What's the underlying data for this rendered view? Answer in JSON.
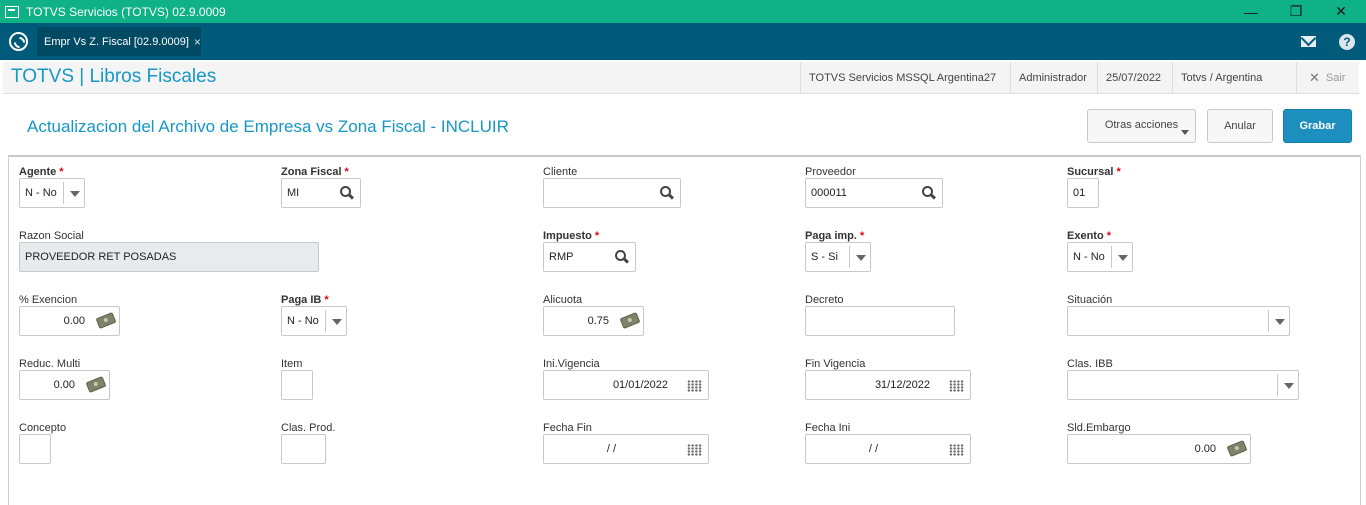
{
  "window": {
    "title": "TOTVS Servicios (TOTVS) 02.9.0009",
    "minimize": "—",
    "maximize": "❐",
    "close": "✕"
  },
  "tabs": [
    {
      "label": "Empr Vs Z. Fiscal [02.9.0009]",
      "close": "×"
    }
  ],
  "header": {
    "app_title": "TOTVS | Libros Fiscales",
    "environment": "TOTVS Servicios MSSQL Argentina27",
    "user": "Administrador",
    "date": "25/07/2022",
    "branch": "Totvs / Argentina",
    "exit_label": "Sair",
    "exit_icon": "✕"
  },
  "page": {
    "title": "Actualizacion del Archivo de Empresa vs Zona Fiscal - INCLUIR"
  },
  "actions": {
    "other_actions": "Otras acciones",
    "cancel": "Anular",
    "save": "Grabar"
  },
  "form": {
    "agente": {
      "label": "Agente",
      "required": "*",
      "value": "N - No"
    },
    "zona_fiscal": {
      "label": "Zona Fiscal",
      "required": "*",
      "value": "MI"
    },
    "cliente": {
      "label": "Cliente",
      "value": ""
    },
    "proveedor": {
      "label": "Proveedor",
      "value": "000011"
    },
    "sucursal": {
      "label": "Sucursal",
      "required": "*",
      "value": "01"
    },
    "razon_social": {
      "label": "Razon Social",
      "value": "PROVEEDOR RET POSADAS"
    },
    "impuesto": {
      "label": "Impuesto",
      "required": "*",
      "value": "RMP"
    },
    "paga_imp": {
      "label": "Paga imp.",
      "required": "*",
      "value": "S - Si"
    },
    "exento": {
      "label": "Exento",
      "required": "*",
      "value": "N - No"
    },
    "pct_exencion": {
      "label": "% Exencion",
      "value": "0.00"
    },
    "paga_ib": {
      "label": "Paga IB",
      "required": "*",
      "value": "N - No"
    },
    "alicuota": {
      "label": "Alicuota",
      "value": "0.75"
    },
    "decreto": {
      "label": "Decreto",
      "value": ""
    },
    "situacion": {
      "label": "Situación",
      "value": ""
    },
    "reduc_multi": {
      "label": "Reduc. Multi",
      "value": "0.00"
    },
    "item": {
      "label": "Item",
      "value": ""
    },
    "ini_vigencia": {
      "label": "Ini.Vigencia",
      "value": "01/01/2022"
    },
    "fin_vigencia": {
      "label": "Fin Vigencia",
      "value": "31/12/2022"
    },
    "clas_ibb": {
      "label": "Clas. IBB",
      "value": ""
    },
    "concepto": {
      "label": "Concepto",
      "value": ""
    },
    "clas_prod": {
      "label": "Clas. Prod.",
      "value": ""
    },
    "fecha_fin": {
      "label": "Fecha Fin",
      "value": "/ /"
    },
    "fecha_ini": {
      "label": "Fecha Ini",
      "value": "/ /"
    },
    "sld_embargo": {
      "label": "Sld.Embargo",
      "value": "0.00"
    }
  },
  "colors": {
    "titlebar": "#0eb286",
    "tabbar": "#005a79",
    "accent": "#1697c6",
    "primary_button": "#1d8fbf",
    "required": "#e0001b"
  },
  "icons": [
    "app-window-icon",
    "totvs-logo-icon",
    "mail-icon",
    "help-icon",
    "search-icon",
    "money-icon",
    "calendar-icon",
    "chevron-down-icon"
  ]
}
